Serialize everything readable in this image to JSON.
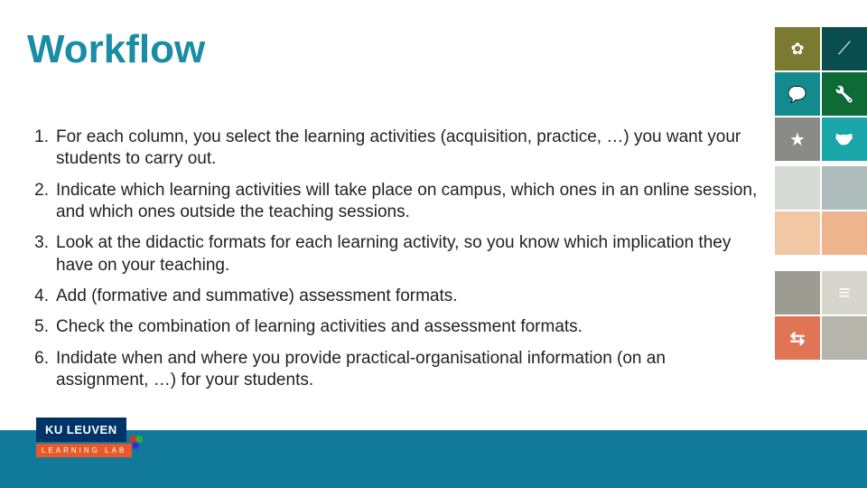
{
  "title": "Workflow",
  "items": [
    "For each column, you select the learning activities (acquisition, practice, …) you want your students to carry out.",
    "Indicate which learning activities will take place on campus, which ones in an online session, and which ones outside the teaching sessions.",
    "Look at the didactic formats for each learning activity, so you know which implication they have on your teaching.",
    "Add (formative and summative) assessment formats.",
    "Check the combination of learning activities and assessment formats.",
    "Indidate when and where you provide practical-organisational information (on an assignment, …) for your students."
  ],
  "footer": {
    "brand_top": "KU LEUVEN",
    "brand_bottom": "LEARNING LAB"
  }
}
